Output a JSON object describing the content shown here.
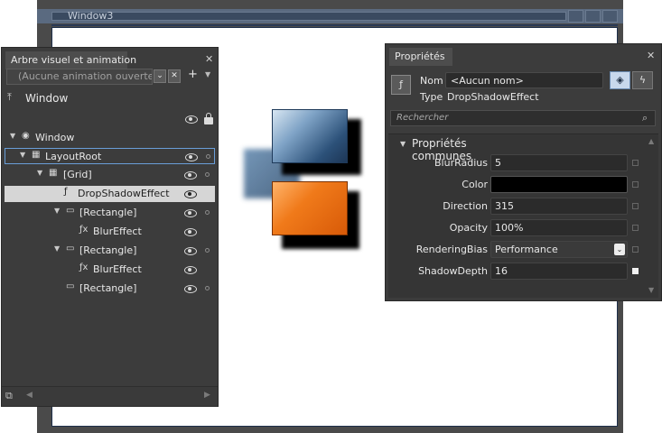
{
  "design_window": {
    "title": "Window3"
  },
  "tree_panel": {
    "title": "Arbre visuel et animation",
    "close_glyph": "✕",
    "animation_placeholder": "(Aucune animation ouverte)",
    "add_glyph": "+",
    "scope_label": "Window",
    "rows": [
      {
        "label": "Window",
        "expanded": true
      },
      {
        "label": "LayoutRoot",
        "expanded": true
      },
      {
        "label": "[Grid]",
        "expanded": true
      },
      {
        "label": "DropShadowEffect"
      },
      {
        "label": "[Rectangle]",
        "expanded": true
      },
      {
        "label": "BlurEffect"
      },
      {
        "label": "[Rectangle]",
        "expanded": true
      },
      {
        "label": "BlurEffect"
      },
      {
        "label": "[Rectangle]"
      }
    ]
  },
  "props_panel": {
    "title": "Propriétés",
    "close_glyph": "✕",
    "name_label": "Nom",
    "name_value": "<Aucun nom>",
    "type_label": "Type",
    "type_value": "DropShadowEffect",
    "search_placeholder": "Rechercher",
    "category": "Propriétés communes",
    "properties": [
      {
        "name": "BlurRadius",
        "value": "5"
      },
      {
        "name": "Color",
        "value": "",
        "color": "#000000"
      },
      {
        "name": "Direction",
        "value": "315"
      },
      {
        "name": "Opacity",
        "value": "100%"
      },
      {
        "name": "RenderingBias",
        "value": "Performance"
      },
      {
        "name": "ShadowDepth",
        "value": "16"
      }
    ]
  },
  "icons": [
    "window-icon",
    "add-icon",
    "eye-icon",
    "lock-icon",
    "grid-icon",
    "effect-icon",
    "rectangle-icon",
    "search-icon",
    "properties-icon",
    "events-icon"
  ]
}
